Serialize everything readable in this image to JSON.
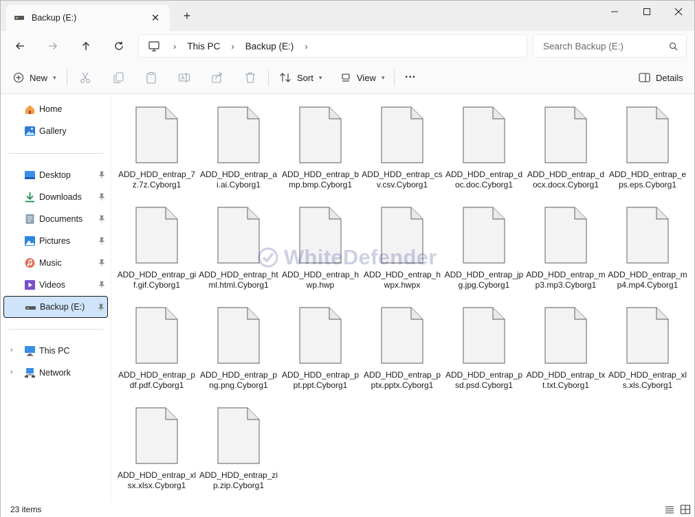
{
  "window": {
    "tab_title": "Backup (E:)",
    "tab_close": "✕",
    "new_tab": "+"
  },
  "address": {
    "crumbs": [
      "This PC",
      "Backup (E:)"
    ],
    "separator": "›"
  },
  "search": {
    "placeholder": "Search Backup (E:)"
  },
  "commands": {
    "new_label": "New",
    "sort_label": "Sort",
    "view_label": "View",
    "more_label": "···",
    "details_label": "Details"
  },
  "sidebar": {
    "pin_glyph": "📌",
    "items": [
      {
        "label": "Home",
        "icon": "home-icon"
      },
      {
        "label": "Gallery",
        "icon": "gallery-icon"
      },
      {
        "label": "Desktop",
        "icon": "desktop-icon",
        "pinned": true
      },
      {
        "label": "Downloads",
        "icon": "downloads-icon",
        "pinned": true
      },
      {
        "label": "Documents",
        "icon": "documents-icon",
        "pinned": true
      },
      {
        "label": "Pictures",
        "icon": "pictures-icon",
        "pinned": true
      },
      {
        "label": "Music",
        "icon": "music-icon",
        "pinned": true
      },
      {
        "label": "Videos",
        "icon": "videos-icon",
        "pinned": true
      },
      {
        "label": "Backup (E:)",
        "icon": "drive-icon",
        "pinned": true,
        "selected": true
      },
      {
        "label": "This PC",
        "icon": "this-pc-icon",
        "expandable": true
      },
      {
        "label": "Network",
        "icon": "network-icon",
        "expandable": true
      }
    ]
  },
  "files": [
    "ADD_HDD_entrap_7z.7z.Cyborg1",
    "ADD_HDD_entrap_ai.ai.Cyborg1",
    "ADD_HDD_entrap_bmp.bmp.Cyborg1",
    "ADD_HDD_entrap_csv.csv.Cyborg1",
    "ADD_HDD_entrap_doc.doc.Cyborg1",
    "ADD_HDD_entrap_docx.docx.Cyborg1",
    "ADD_HDD_entrap_eps.eps.Cyborg1",
    "ADD_HDD_entrap_gif.gif.Cyborg1",
    "ADD_HDD_entrap_html.html.Cyborg1",
    "ADD_HDD_entrap_hwp.hwp",
    "ADD_HDD_entrap_hwpx.hwpx",
    "ADD_HDD_entrap_jpg.jpg.Cyborg1",
    "ADD_HDD_entrap_mp3.mp3.Cyborg1",
    "ADD_HDD_entrap_mp4.mp4.Cyborg1",
    "ADD_HDD_entrap_pdf.pdf.Cyborg1",
    "ADD_HDD_entrap_png.png.Cyborg1",
    "ADD_HDD_entrap_ppt.ppt.Cyborg1",
    "ADD_HDD_entrap_pptx.pptx.Cyborg1",
    "ADD_HDD_entrap_psd.psd.Cyborg1",
    "ADD_HDD_entrap_txt.txt.Cyborg1",
    "ADD_HDD_entrap_xls.xls.Cyborg1",
    "ADD_HDD_entrap_xlsx.xlsx.Cyborg1",
    "ADD_HDD_entrap_zip.zip.Cyborg1"
  ],
  "watermark": "WhiteDefender",
  "status": {
    "item_count": "23 items"
  },
  "colors": {
    "accent": "#0067c0",
    "selection_bg": "#cfe4f8",
    "file_icon_fill": "#f3f3f3",
    "file_icon_stroke": "#7a7a7a"
  }
}
